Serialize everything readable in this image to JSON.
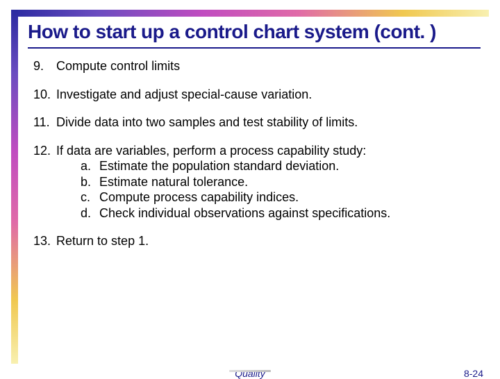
{
  "title": "How to start up a control chart system (cont. )",
  "items": [
    {
      "num": "9.",
      "text": "Compute control limits"
    },
    {
      "num": "10.",
      "text": "Investigate and adjust special-cause variation."
    },
    {
      "num": "11.",
      "text": "Divide data into two samples and test stability of limits."
    },
    {
      "num": "12.",
      "text": "If data are variables, perform a process capability study:",
      "sub": [
        {
          "letter": "a.",
          "text": "Estimate the population standard deviation."
        },
        {
          "letter": "b.",
          "text": "Estimate natural tolerance."
        },
        {
          "letter": "c.",
          "text": "Compute process capability indices."
        },
        {
          "letter": "d.",
          "text": "Check individual observations against specifications."
        }
      ]
    },
    {
      "num": "13.",
      "text": "Return to step 1."
    }
  ],
  "footer": {
    "center": "Quality",
    "right": "8-24"
  }
}
